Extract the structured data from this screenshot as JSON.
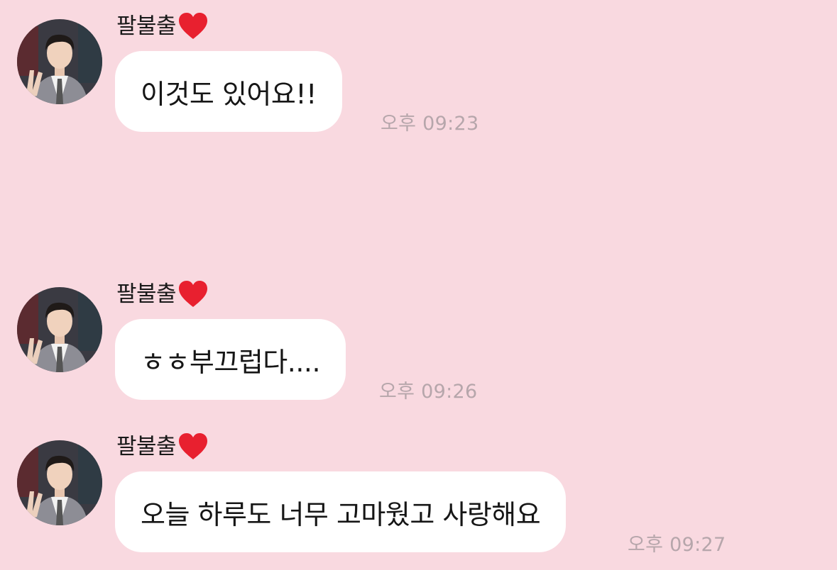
{
  "theme": {
    "background": "#f9d9e0",
    "bubble": "#ffffff",
    "timestamp_color": "#b6a6ab",
    "heart_color": "#e8202f"
  },
  "messages": [
    {
      "sender": "팔불출",
      "sender_icon": "red-heart-icon",
      "text": "이것도 있어요!!",
      "time": "오후 09:23"
    },
    {
      "sender": "팔불출",
      "sender_icon": "red-heart-icon",
      "text": "ㅎㅎ부끄럽다....",
      "time": "오후 09:26"
    },
    {
      "sender": "팔불출",
      "sender_icon": "red-heart-icon",
      "text": "오늘 하루도 너무 고마웠고 사랑해요",
      "time": "오후 09:27"
    }
  ]
}
